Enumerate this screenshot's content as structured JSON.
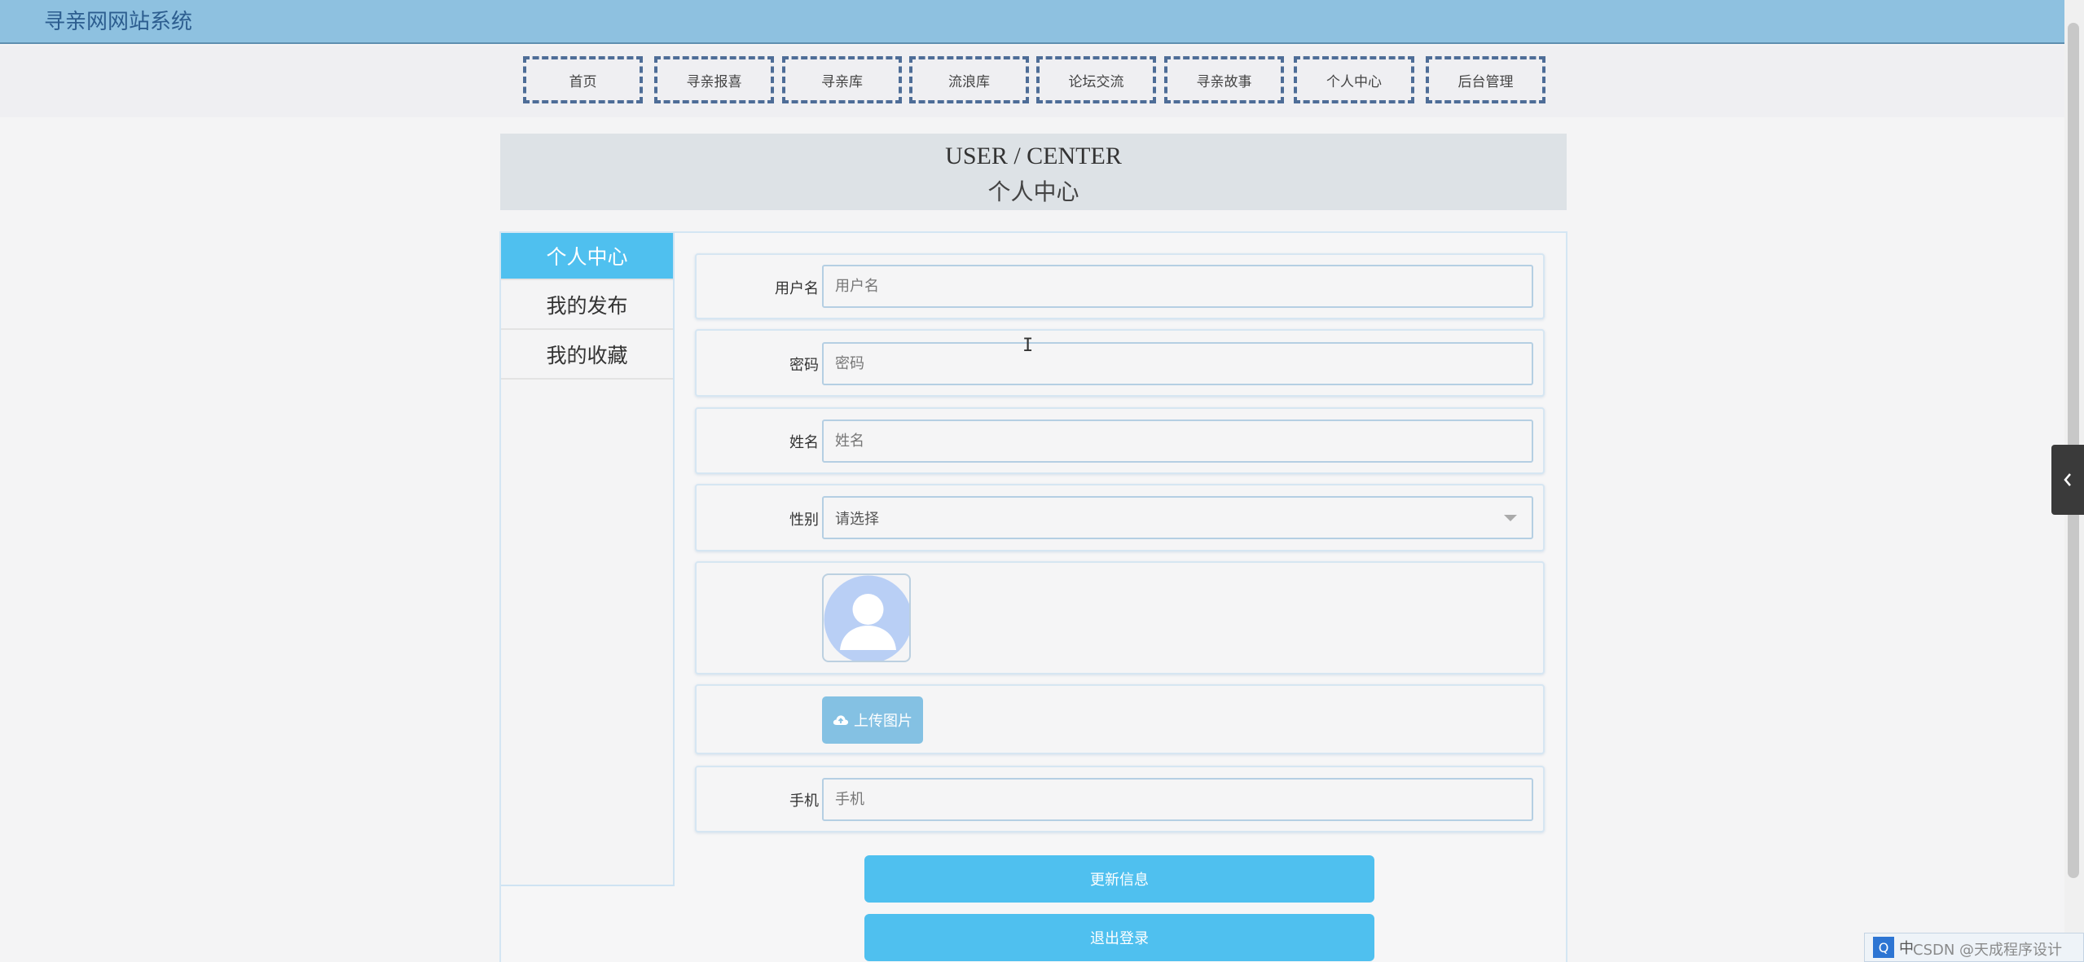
{
  "site": {
    "title": "寻亲网网站系统"
  },
  "nav": {
    "items": [
      {
        "label": "首页"
      },
      {
        "label": "寻亲报喜"
      },
      {
        "label": "寻亲库"
      },
      {
        "label": "流浪库"
      },
      {
        "label": "论坛交流"
      },
      {
        "label": "寻亲故事"
      },
      {
        "label": "个人中心"
      },
      {
        "label": "后台管理"
      }
    ]
  },
  "banner": {
    "en": "USER / CENTER",
    "cn": "个人中心"
  },
  "sidemenu": {
    "items": [
      {
        "label": "个人中心",
        "active": true
      },
      {
        "label": "我的发布",
        "active": false
      },
      {
        "label": "我的收藏",
        "active": false
      }
    ]
  },
  "form": {
    "username": {
      "label": "用户名",
      "placeholder": "用户名",
      "value": ""
    },
    "password": {
      "label": "密码",
      "placeholder": "密码",
      "value": ""
    },
    "name": {
      "label": "姓名",
      "placeholder": "姓名",
      "value": ""
    },
    "gender": {
      "label": "性别",
      "selected": "请选择"
    },
    "upload": {
      "label": "上传图片"
    },
    "phone": {
      "label": "手机",
      "placeholder": "手机",
      "value": ""
    }
  },
  "actions": {
    "update": "更新信息",
    "logout": "退出登录"
  },
  "tray": {
    "ime": "中"
  },
  "watermark": "CSDN @天成程序设计",
  "colors": {
    "topbar": "#8ec1e0",
    "accent": "#4fc0ef",
    "nav_border": "#4e6d97",
    "upload": "#84c1e3"
  }
}
